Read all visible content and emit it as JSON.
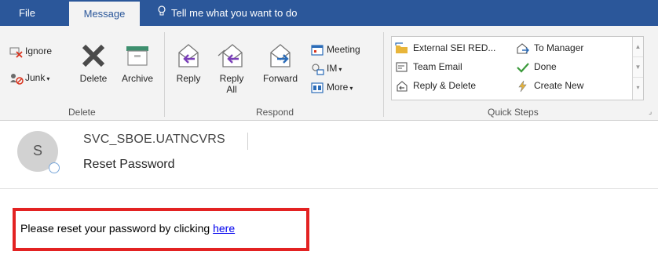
{
  "tabs": {
    "file": "File",
    "message": "Message",
    "tellme": "Tell me what you want to do"
  },
  "ribbon": {
    "delete_group": {
      "ignore": "Ignore",
      "junk": "Junk",
      "delete": "Delete",
      "archive": "Archive",
      "label": "Delete"
    },
    "respond_group": {
      "reply": "Reply",
      "reply_all_1": "Reply",
      "reply_all_2": "All",
      "forward": "Forward",
      "meeting": "Meeting",
      "im": "IM",
      "more": "More",
      "label": "Respond"
    },
    "quick_steps": {
      "external": "External SEI RED...",
      "team_email": "Team Email",
      "reply_delete": "Reply & Delete",
      "to_manager": "To Manager",
      "done": "Done",
      "create_new": "Create New",
      "label": "Quick Steps"
    }
  },
  "message": {
    "avatar_initial": "S",
    "sender": "SVC_SBOE.UATNCVRS",
    "subject": "Reset Password",
    "body_prefix": "Please reset your password by clicking ",
    "body_link": "here"
  },
  "colors": {
    "tabbar": "#2b579a",
    "highlight": "#e32222",
    "link": "#0000ee"
  }
}
